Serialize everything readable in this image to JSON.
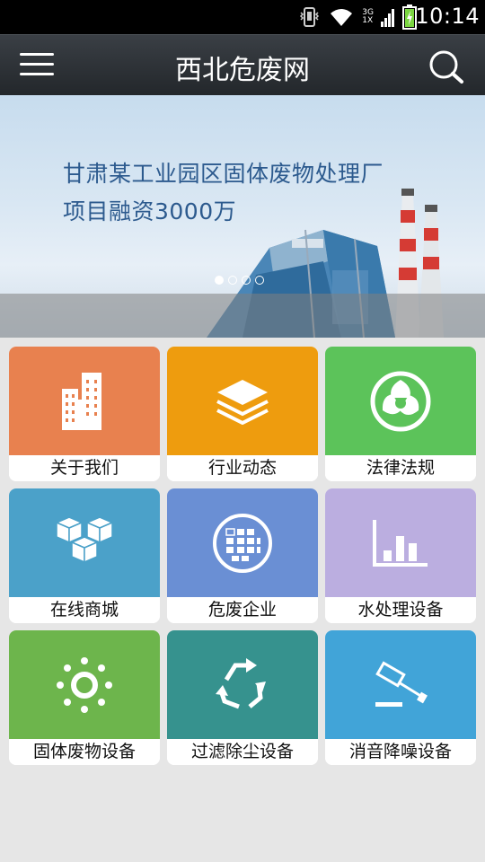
{
  "status_bar": {
    "time": "10:14",
    "network_top": "3G",
    "network_bottom": "1X",
    "icons": [
      "vibrate-icon",
      "wifi-icon",
      "signal-icon",
      "battery-icon"
    ]
  },
  "header": {
    "title": "西北危废网",
    "menu_icon": "menu-icon",
    "search_icon": "search-icon",
    "background": "#2b2f34"
  },
  "banner": {
    "line1": "甘肃某工业园区固体废物处理厂",
    "line2": "项目融资3000万",
    "slide_count": 4,
    "active_slide": 1,
    "text_color": "#2c5a8e"
  },
  "tiles": [
    {
      "label": "关于我们",
      "icon": "building-icon",
      "color": "#e8814f"
    },
    {
      "label": "行业动态",
      "icon": "layers-icon",
      "color": "#ee9c0e"
    },
    {
      "label": "法律法规",
      "icon": "aperture-icon",
      "color": "#5cc35a"
    },
    {
      "label": "在线商城",
      "icon": "cubes-icon",
      "color": "#4ba1c9"
    },
    {
      "label": "危废企业",
      "icon": "grid-circle-icon",
      "color": "#6a8fd4"
    },
    {
      "label": "水处理设备",
      "icon": "bar-chart-icon",
      "color": "#bbaee0"
    },
    {
      "label": "固体废物设备",
      "icon": "sun-icon",
      "color": "#6db54c"
    },
    {
      "label": "过滤除尘设备",
      "icon": "recycle-icon",
      "color": "#36928e"
    },
    {
      "label": "消音降噪设备",
      "icon": "gavel-icon",
      "color": "#41a4d8"
    }
  ]
}
